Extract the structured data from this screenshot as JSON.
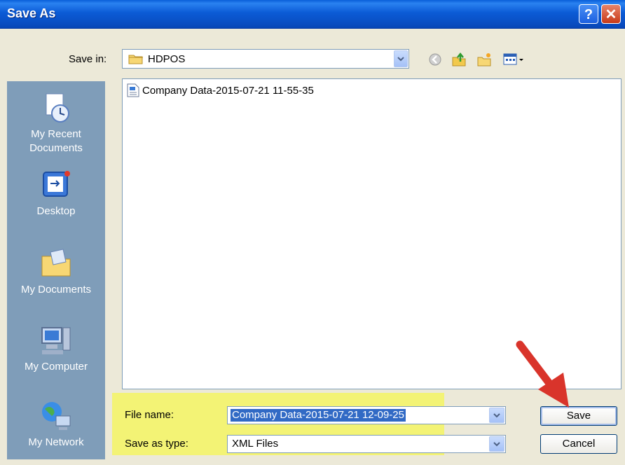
{
  "window": {
    "title": "Save As"
  },
  "toolbar": {
    "save_in_label": "Save in:",
    "save_in_value": "HDPOS",
    "icons": [
      "back-icon",
      "up-folder-icon",
      "new-folder-icon",
      "views-menu-icon"
    ]
  },
  "places": [
    {
      "line1": "My Recent",
      "line2": "Documents",
      "icon": "recent-documents-icon"
    },
    {
      "line1": "Desktop",
      "line2": "",
      "icon": "desktop-icon"
    },
    {
      "line1": "My Documents",
      "line2": "",
      "icon": "my-documents-icon"
    },
    {
      "line1": "My Computer",
      "line2": "",
      "icon": "my-computer-icon"
    },
    {
      "line1": "My Network",
      "line2": "",
      "icon": "my-network-icon"
    }
  ],
  "files": [
    {
      "name": "Company Data-2015-07-21 11-55-35",
      "icon": "xml-file-icon"
    }
  ],
  "form": {
    "file_name_label": "File name:",
    "file_name_value": "Company Data-2015-07-21 12-09-25",
    "save_as_type_label": "Save as type:",
    "save_as_type_value": "XML Files"
  },
  "buttons": {
    "save": "Save",
    "cancel": "Cancel"
  },
  "colors": {
    "highlight": "#f4f464",
    "arrow": "#d9342b",
    "titlebar": "#0a5fd8"
  }
}
